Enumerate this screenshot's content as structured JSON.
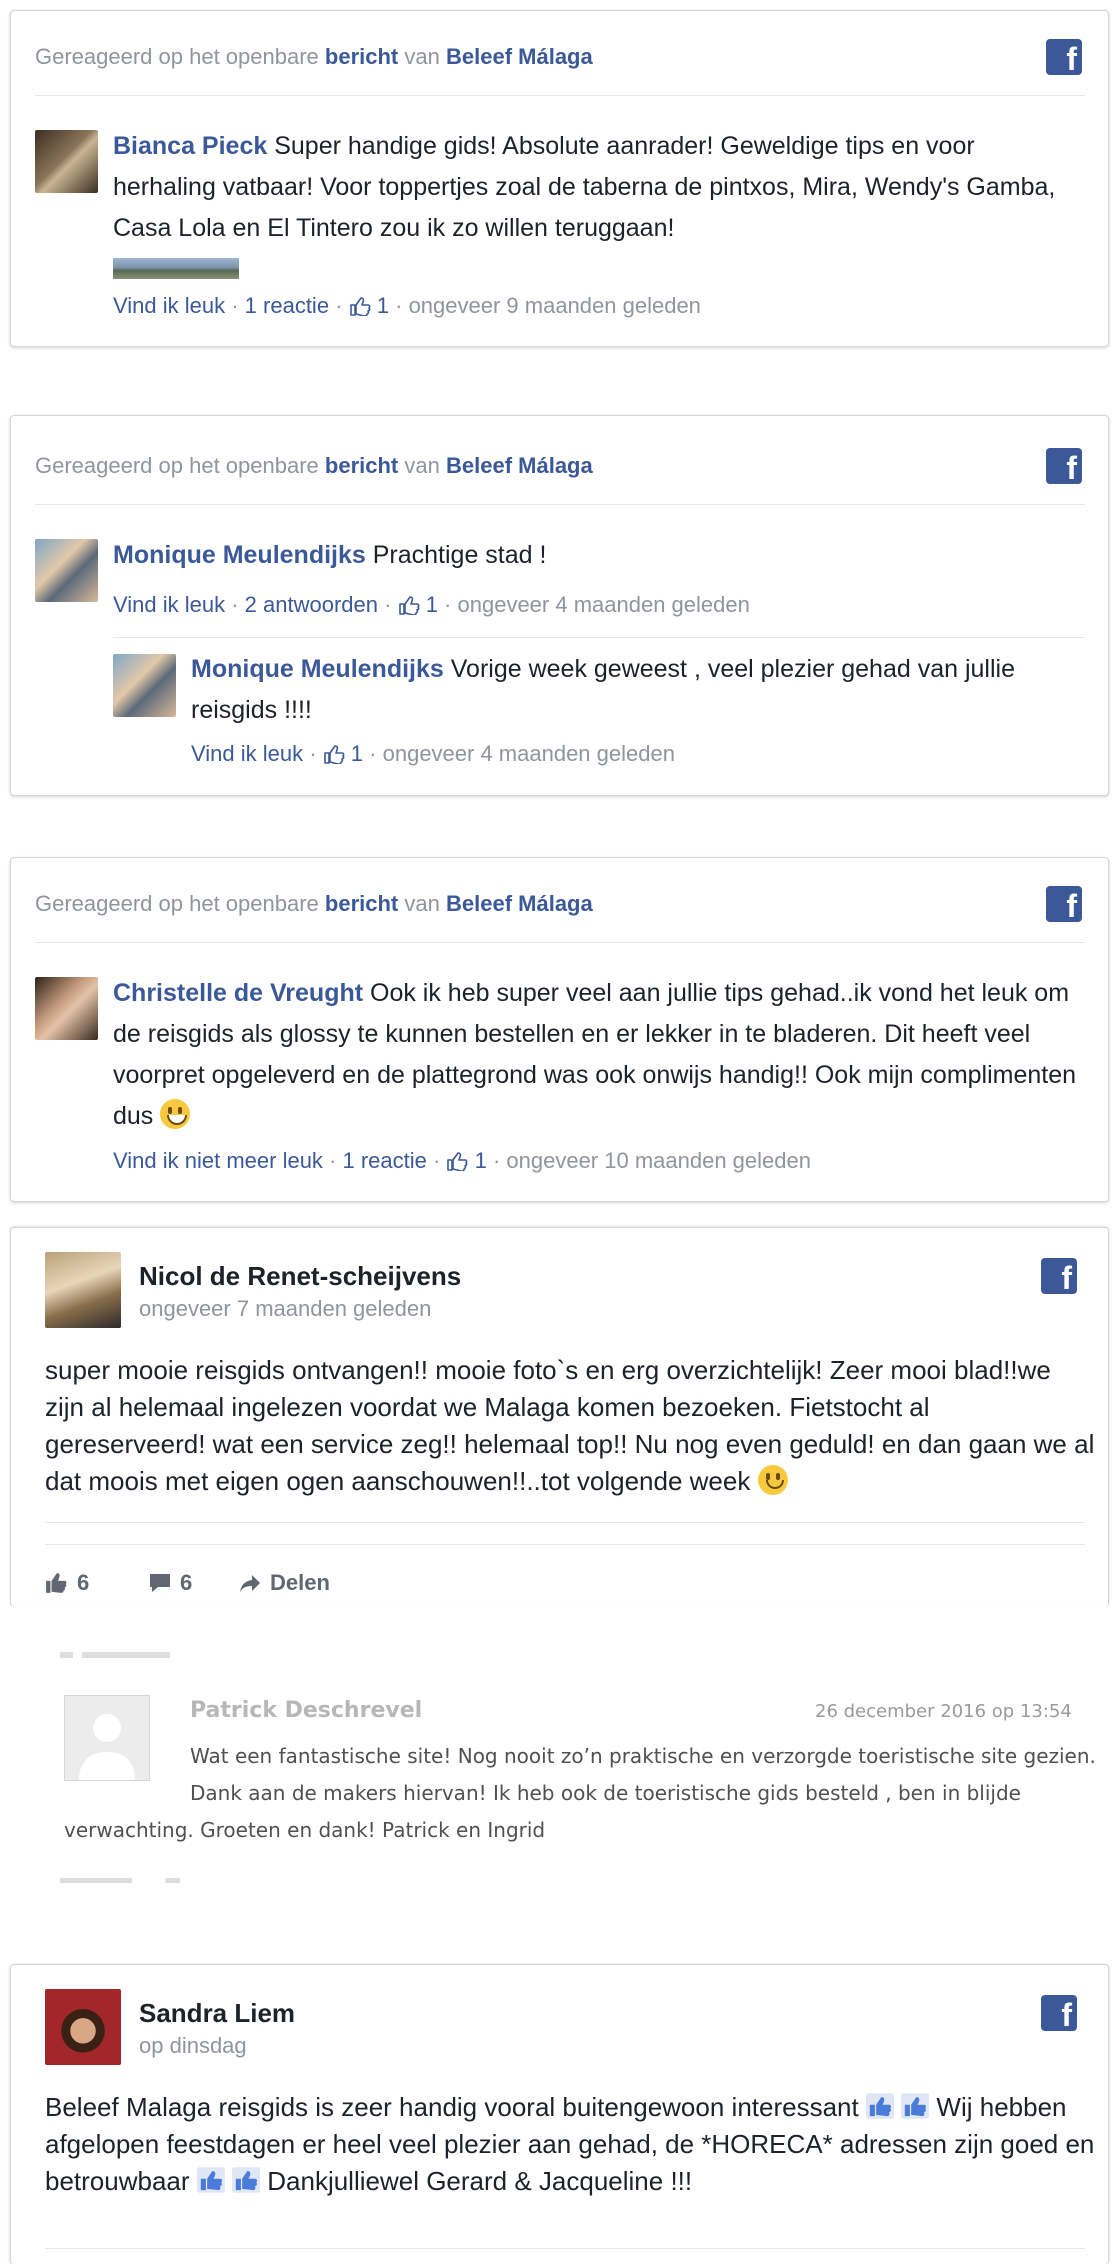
{
  "brand_color": "#3b5998",
  "facebook_icon": "facebook-icon",
  "header": {
    "prefix": "Gereageerd op het openbare",
    "post_word": "bericht",
    "middle": "van",
    "page_name": "Beleef Málaga"
  },
  "card1": {
    "author": "Bianca Pieck",
    "comment": "Super handige gids! Absolute aanrader! Geweldige tips en voor herhaling vatbaar! Voor toppertjes zoal de taberna de pintxos, Mira, Wendy's Gamba, Casa Lola en El Tintero zou ik zo willen teruggaan!",
    "like": "Vind ik leuk",
    "replies": "1 reactie",
    "likes": "1",
    "time": "ongeveer 9 maanden geleden"
  },
  "card2": {
    "author": "Monique Meulendijks",
    "comment": "Prachtige stad !",
    "like": "Vind ik leuk",
    "replies": "2 antwoorden",
    "likes": "1",
    "time": "ongeveer 4 maanden geleden",
    "reply": {
      "author": "Monique Meulendijks",
      "comment": "Vorige week geweest , veel plezier gehad van jullie reisgids !!!!",
      "like": "Vind ik leuk",
      "likes": "1",
      "time": "ongeveer 4 maanden geleden"
    }
  },
  "card3": {
    "author": "Christelle de Vreught",
    "comment": "Ook ik heb super veel aan jullie tips gehad..ik vond het leuk om de reisgids als glossy te kunnen bestellen en er lekker in te bladeren. Dit heeft veel voorpret opgeleverd en de plattegrond was ook onwijs handig!! Ook mijn complimenten dus",
    "emoji": "grinning-face",
    "like": "Vind ik niet meer leuk",
    "replies": "1 reactie",
    "likes": "1",
    "time": "ongeveer 10 maanden geleden"
  },
  "card4": {
    "author": "Nicol de Renet-scheijvens",
    "time": "ongeveer 7 maanden geleden",
    "body": "super mooie reisgids ontvangen!! mooie foto`s en erg overzichtelijk! Zeer mooi blad!!we zijn al helemaal ingelezen voordat we Malaga komen bezoeken. Fietstocht al gereserveerd! wat een service zeg!! helemaal top!! Nu nog even geduld! en dan gaan we al dat moois met eigen ogen aanschouwen!!..tot volgende week",
    "emoji": "slightly-smiling-face",
    "likes": "6",
    "comments": "6",
    "share": "Delen"
  },
  "card5": {
    "author": "Patrick Deschrevel",
    "date": "26 december 2016 op 13:54",
    "line1": "Wat een fantastische site! Nog nooit zo’n praktische en verzorgde toeristische site gezien.",
    "line2": "Dank aan de makers hiervan! Ik heb ook de toeristische gids besteld , ben in blijde",
    "line3": "verwachting. Groeten en dank! Patrick en Ingrid"
  },
  "card6": {
    "author": "Sandra Liem",
    "time": "op dinsdag",
    "part1": "Beleef Malaga reisgids is zeer handig vooral buitengewoon interessant",
    "part2": "Wij hebben afgelopen feestdagen er heel veel plezier aan gehad, de *HORECA* adressen zijn goed en betrouwbaar",
    "part3": "Dankjulliewel Gerard & Jacqueline !!!"
  }
}
